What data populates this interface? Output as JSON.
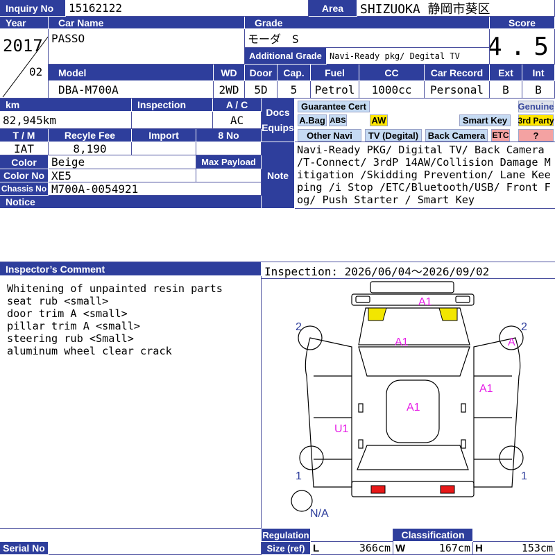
{
  "header": {
    "inquiry_label": "Inquiry No",
    "inquiry_no": "15162122",
    "area_label": "Area",
    "area": "SHIZUOKA 静岡市葵区"
  },
  "labels": {
    "year": "Year",
    "car_name": "Car Name",
    "grade": "Grade",
    "score": "Score",
    "additional_grade": "Additional Grade",
    "model": "Model",
    "wd": "WD",
    "door": "Door",
    "cap": "Cap.",
    "fuel": "Fuel",
    "cc": "CC",
    "car_record": "Car Record",
    "ext": "Ext",
    "int": "Int",
    "km": "km",
    "inspection": "Inspection",
    "ac": "A / C",
    "docs": "Docs",
    "equips": "Equips",
    "tm": "T / M",
    "recycle_fee": "Recyle Fee",
    "import": "Import",
    "eight_no": "8 No",
    "color": "Color",
    "max_payload": "Max Payload",
    "color_no": "Color No",
    "chassis_no": "Chassis No",
    "notice": "Notice",
    "note": "Note",
    "inspector_comment": "Inspector’s Comment",
    "serial_no": "Serial No",
    "regulation": "Regulation",
    "size_ref": "Size (ref)",
    "classification": "Classification",
    "l": "L",
    "w": "W",
    "h": "H"
  },
  "vehicle": {
    "year": "2017",
    "month": "02",
    "car_name": "PASSO",
    "grade": "モーダ　S",
    "additional_grade": "Navi-Ready pkg/ Degital TV",
    "score": "4.5",
    "model": "DBA-M700A",
    "wd": "2WD",
    "door": "5D",
    "cap": "5",
    "fuel": "Petrol",
    "cc": "1000cc",
    "car_record": "Personal",
    "ext": "B",
    "int": "B",
    "km": "82,945km",
    "inspection": "",
    "ac": "AC",
    "tm": "IAT",
    "recycle_fee": "8,190",
    "import": "",
    "eight_no": "",
    "color": "Beige",
    "max_payload": "",
    "color_no": "XE5",
    "chassis_no": "M700A-0054921"
  },
  "equips": {
    "guarantee_cert": "Guarantee Cert",
    "genuine": "Genuine",
    "abag": "A.Bag",
    "abs": "ABS",
    "aw": "AW",
    "smart_key": "Smart Key",
    "third_party": "3rd Party",
    "other_navi": "Other Navi",
    "tv_digital": "TV (Degital)",
    "back_camera": "Back Camera",
    "etc": "ETC",
    "question": "?"
  },
  "note": "Navi-Ready PKG/ Digital TV/ Back Camera /T-Connect/ 3rdP 14AW/Collision Damage Mitigation /Skidding Prevention/ Lane Keeping /i Stop /ETC/Bluetooth/USB/ Front Fog/ Push Starter / Smart Key",
  "inspector_comment": "Whitening of unpainted resin parts\nseat rub <small>\ndoor trim A <small>\npillar trim A <small>\nsteering rub <Small>\naluminum wheel clear crack",
  "inspection_period": "Inspection: 2026/06/04～2026/09/02",
  "damage_marks": {
    "hood_front": "A1",
    "hood": "A1",
    "roof": "A1",
    "right_side": "A1",
    "left_side": "U1",
    "right_front_wheel": "A",
    "num_2_left": "2",
    "num_2_right": "2",
    "num_1_left": "1",
    "num_1_right": "1",
    "spare": "N/A"
  },
  "size": {
    "l": "366cm",
    "w": "167cm",
    "h": "153cm"
  },
  "colors": {
    "header": "#2e3e9c",
    "mark": "#e61ee6",
    "yellow": "#f2e600",
    "red": "#e81818"
  }
}
